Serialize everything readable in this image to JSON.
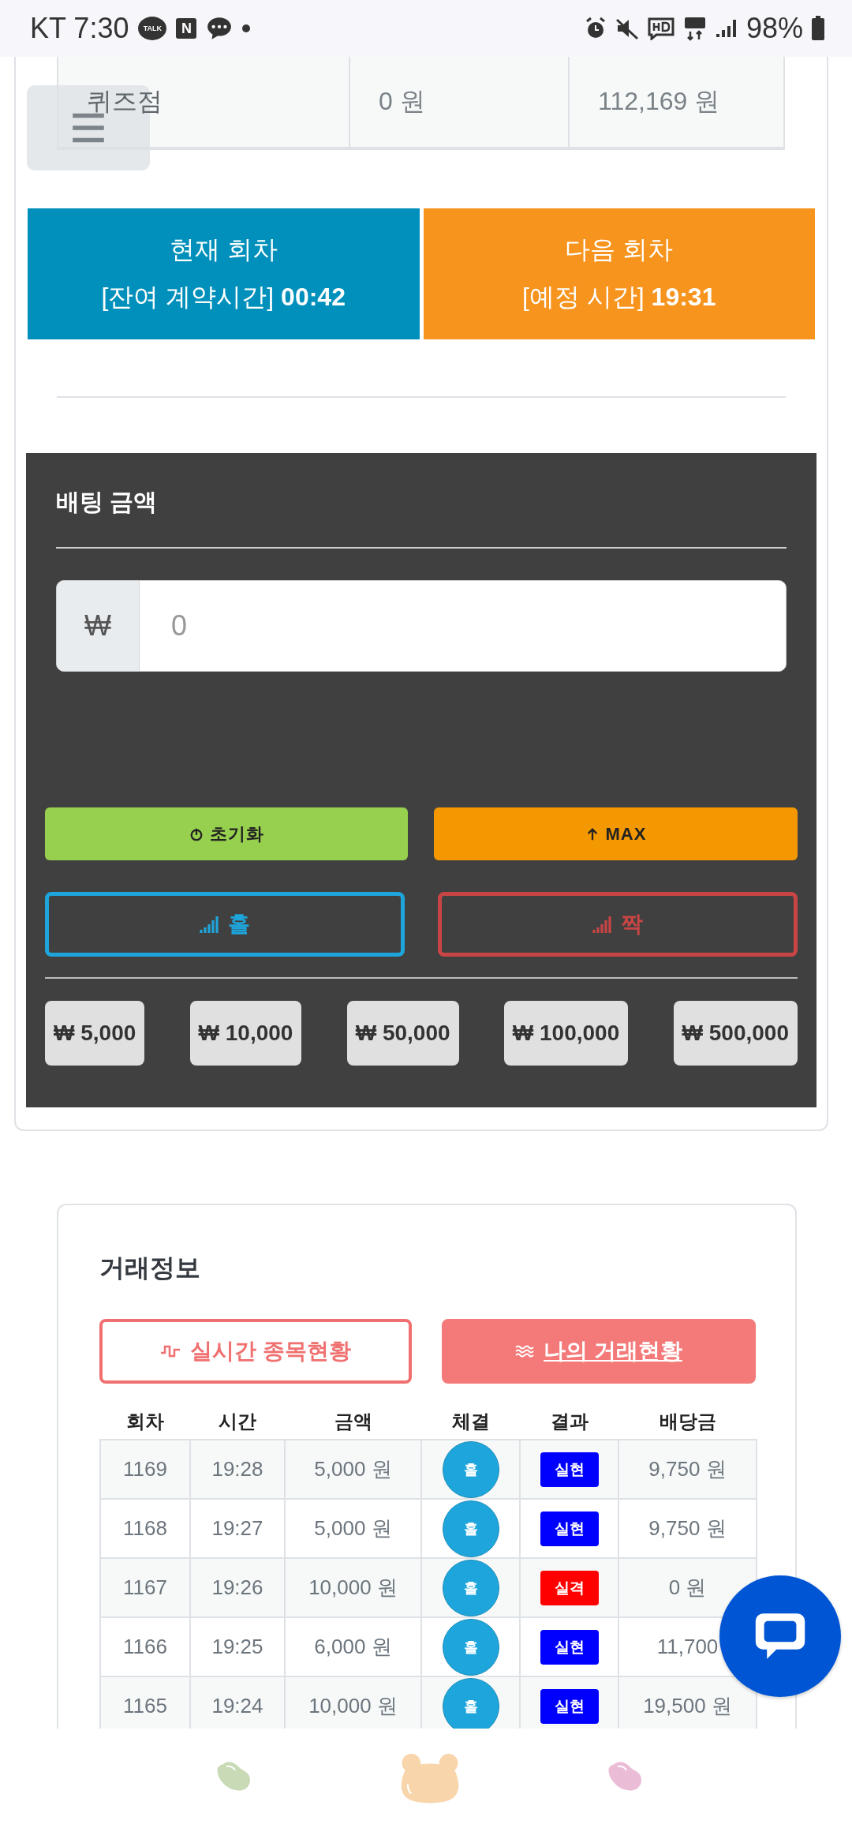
{
  "status_bar": {
    "carrier_time": "KT 7:30",
    "notification_icons": [
      "TALK",
      "N"
    ],
    "battery": "98%"
  },
  "summary_row": {
    "cells": [
      "퀴즈점",
      "0 원",
      "112,169 원"
    ]
  },
  "rounds": [
    {
      "kind": "current",
      "title": "현재 회차",
      "label": "[잔여 계약시간]",
      "time": "00:42"
    },
    {
      "kind": "next",
      "title": "다음 회차",
      "label": "[예정 시간]",
      "time": "19:31"
    }
  ],
  "betting": {
    "title": "배팅 금액",
    "currency": "₩",
    "amount": {
      "placeholder": "0"
    },
    "actions": [
      {
        "kind": "reset",
        "label": "초기화"
      },
      {
        "kind": "max",
        "label": "MAX"
      }
    ],
    "picks": [
      {
        "kind": "odd",
        "label": "홀"
      },
      {
        "kind": "even",
        "label": "짝"
      }
    ],
    "chips": [
      "₩ 5,000",
      "₩ 10,000",
      "₩ 50,000",
      "₩ 100,000",
      "₩ 500,000"
    ]
  },
  "trades": {
    "title": "거래정보",
    "tabs": [
      {
        "label": "실시간 종목현황",
        "selected": false
      },
      {
        "label": "나의 거래현황",
        "selected": true
      }
    ],
    "columns": [
      "회차",
      "시간",
      "금액",
      "체결",
      "결과",
      "배당금"
    ],
    "rows": [
      {
        "round": "1169",
        "time": "19:28",
        "amount": "5,000 원",
        "pick": "홀",
        "result": "실현",
        "color": "#0000ff",
        "payout": "9,750 원"
      },
      {
        "round": "1168",
        "time": "19:27",
        "amount": "5,000 원",
        "pick": "홀",
        "result": "실현",
        "color": "#0000ff",
        "payout": "9,750 원"
      },
      {
        "round": "1167",
        "time": "19:26",
        "amount": "10,000 원",
        "pick": "홀",
        "result": "실격",
        "color": "#ff0000",
        "payout": "0 원"
      },
      {
        "round": "1166",
        "time": "19:25",
        "amount": "6,000 원",
        "pick": "홀",
        "result": "실현",
        "color": "#0000ff",
        "payout": "11,700"
      },
      {
        "round": "1165",
        "time": "19:24",
        "amount": "10,000 원",
        "pick": "홀",
        "result": "실현",
        "color": "#0000ff",
        "payout": "19,500 원"
      }
    ]
  }
}
